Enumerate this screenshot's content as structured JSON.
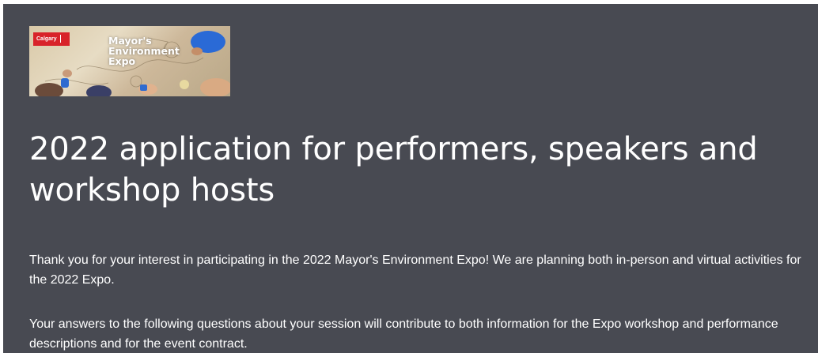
{
  "banner": {
    "logo_text": "Calgary",
    "title_text": "Mayor's\nEnvironment\nExpo",
    "alt": "Mayor's Environment Expo banner image"
  },
  "form": {
    "title": "2022 application for performers, speakers and workshop hosts",
    "description_1": "Thank you for your interest in participating in the 2022 Mayor's Environment Expo! We are planning both in-person and virtual activities for the 2022 Expo.",
    "description_2": "Your answers to the following questions about your session will contribute to both information for the Expo workshop and performance descriptions and for the event contract."
  },
  "colors": {
    "header_background": "#484a52",
    "text": "#ffffff",
    "logo_red": "#d8232a"
  }
}
